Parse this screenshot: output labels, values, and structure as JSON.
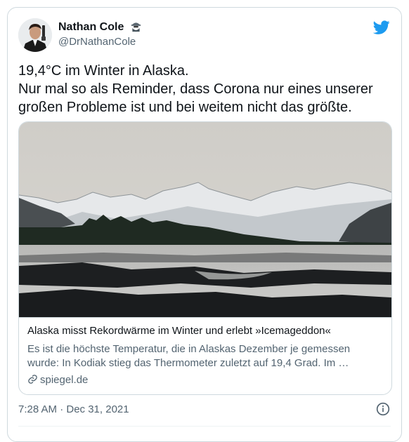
{
  "author": {
    "name": "Nathan Cole",
    "handle": "@DrNathanCole"
  },
  "tweet": {
    "lines": [
      "19,4°C im Winter in Alaska.",
      "Nur mal so als Reminder, dass Corona nur eines unserer",
      "großen Probleme ist und bei weitem nicht das größte."
    ]
  },
  "link_card": {
    "title": "Alaska misst Rekordwärme im Winter und erlebt »Icemageddon«",
    "description_lines": [
      "Es ist die höchste Temperatur, die in Alaskas Dezember je gemessen",
      "wurde: In Kodiak stieg das Thermometer zuletzt auf 19,4 Grad. Im …"
    ],
    "domain": "spiegel.de"
  },
  "timestamp": "7:28 AM · Dec 31, 2021",
  "icons": {
    "brand": "twitter-bird-icon",
    "badge": "detective-emoji-icon",
    "link": "link-icon",
    "info": "info-icon"
  },
  "colors": {
    "brand": "#1d9bf0",
    "text": "#0f1419",
    "secondary": "#536471",
    "border": "#cfd9de"
  }
}
